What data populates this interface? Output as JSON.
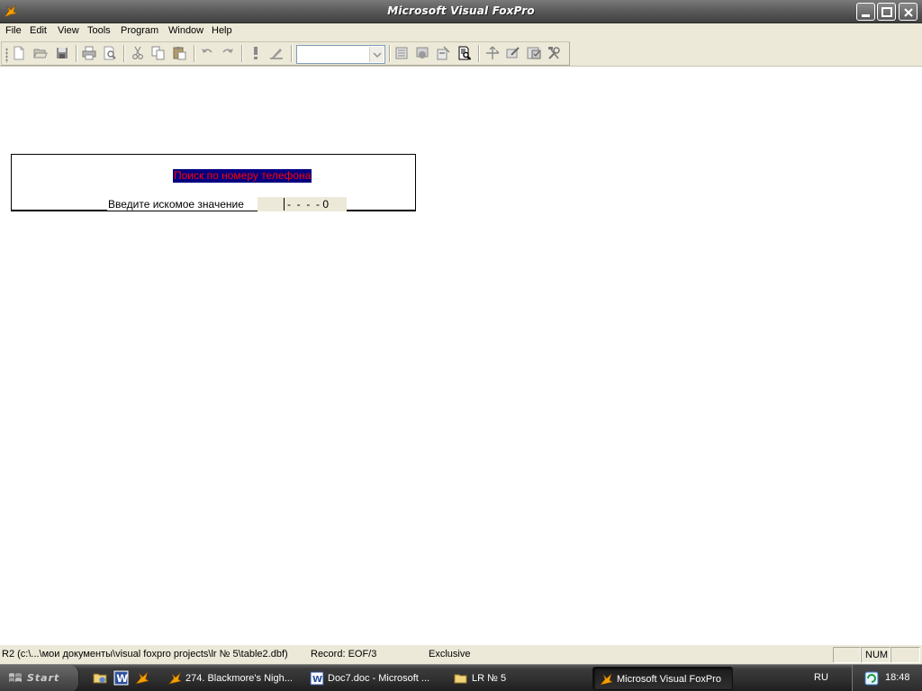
{
  "window": {
    "title": "Microsoft Visual FoxPro",
    "icon": "foxpro-icon"
  },
  "menu": {
    "items": [
      "File",
      "Edit",
      "View",
      "Tools",
      "Program",
      "Window",
      "Help"
    ]
  },
  "toolbar": {
    "combo_value": "",
    "icons": [
      "new-file-icon",
      "open-folder-icon",
      "save-icon",
      "print-icon",
      "print-preview-icon",
      "cut-icon",
      "copy-icon",
      "paste-icon",
      "undo-icon",
      "redo-icon",
      "run-icon",
      "modify-form-icon",
      "data-session-icon",
      "form-wizard-icon",
      "report-wizard-icon",
      "browse-icon",
      "code-icon",
      "builder-icon",
      "properties-icon",
      "tools-icon"
    ]
  },
  "form": {
    "title": "Поиск по номеру телефона",
    "label": "Введите искомое значение",
    "input_mask": "-  -  -  - 0"
  },
  "statusbar": {
    "path": "R2 (c:\\...\\мои документы\\visual foxpro projects\\lr № 5\\table2.dbf)",
    "record": "Record: EOF/3",
    "mode": "Exclusive",
    "num": "NUM"
  },
  "taskbar": {
    "start_label": "Start",
    "tasks": [
      {
        "label": "274. Blackmore's Nigh...",
        "icon": "foxpro-icon"
      },
      {
        "label": "Doc7.doc - Microsoft ...",
        "icon": "word-icon"
      },
      {
        "label": "LR № 5",
        "icon": "folder-icon"
      },
      {
        "label": "Microsoft Visual FoxPro",
        "icon": "foxpro-icon"
      }
    ],
    "language": "RU",
    "clock": "18:48"
  },
  "colors": {
    "form_title_bg": "#000080",
    "form_title_fg": "#ff0000",
    "chrome": "#ece9d8"
  }
}
